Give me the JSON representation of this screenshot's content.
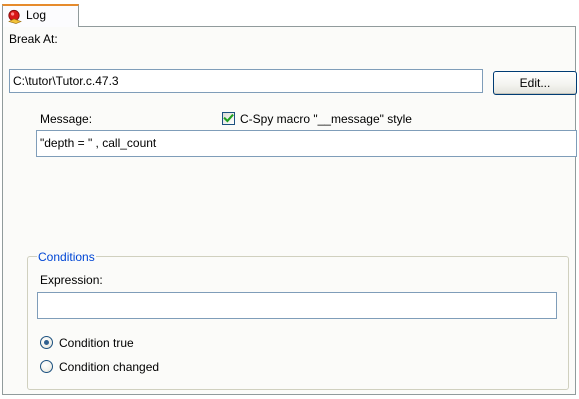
{
  "tab": {
    "label": "Log",
    "icon": "breakpoint-icon"
  },
  "break_at": {
    "label": "Break At:",
    "value": "C:\\tutor\\Tutor.c.47.3",
    "edit_button": "Edit..."
  },
  "message": {
    "label": "Message:",
    "checkbox_label": "C-Spy macro \"__message\" style",
    "checkbox_checked": true,
    "value": "\"depth = \" , call_count"
  },
  "conditions": {
    "legend": "Conditions",
    "expression_label": "Expression:",
    "expression_value": "",
    "options": [
      {
        "label": "Condition true",
        "selected": true
      },
      {
        "label": "Condition changed",
        "selected": false
      }
    ]
  },
  "colors": {
    "groupbox_title": "#0046d5",
    "checkmark": "#21a121",
    "tab_highlight": "#e68b2c",
    "input_border": "#7f9db9"
  }
}
